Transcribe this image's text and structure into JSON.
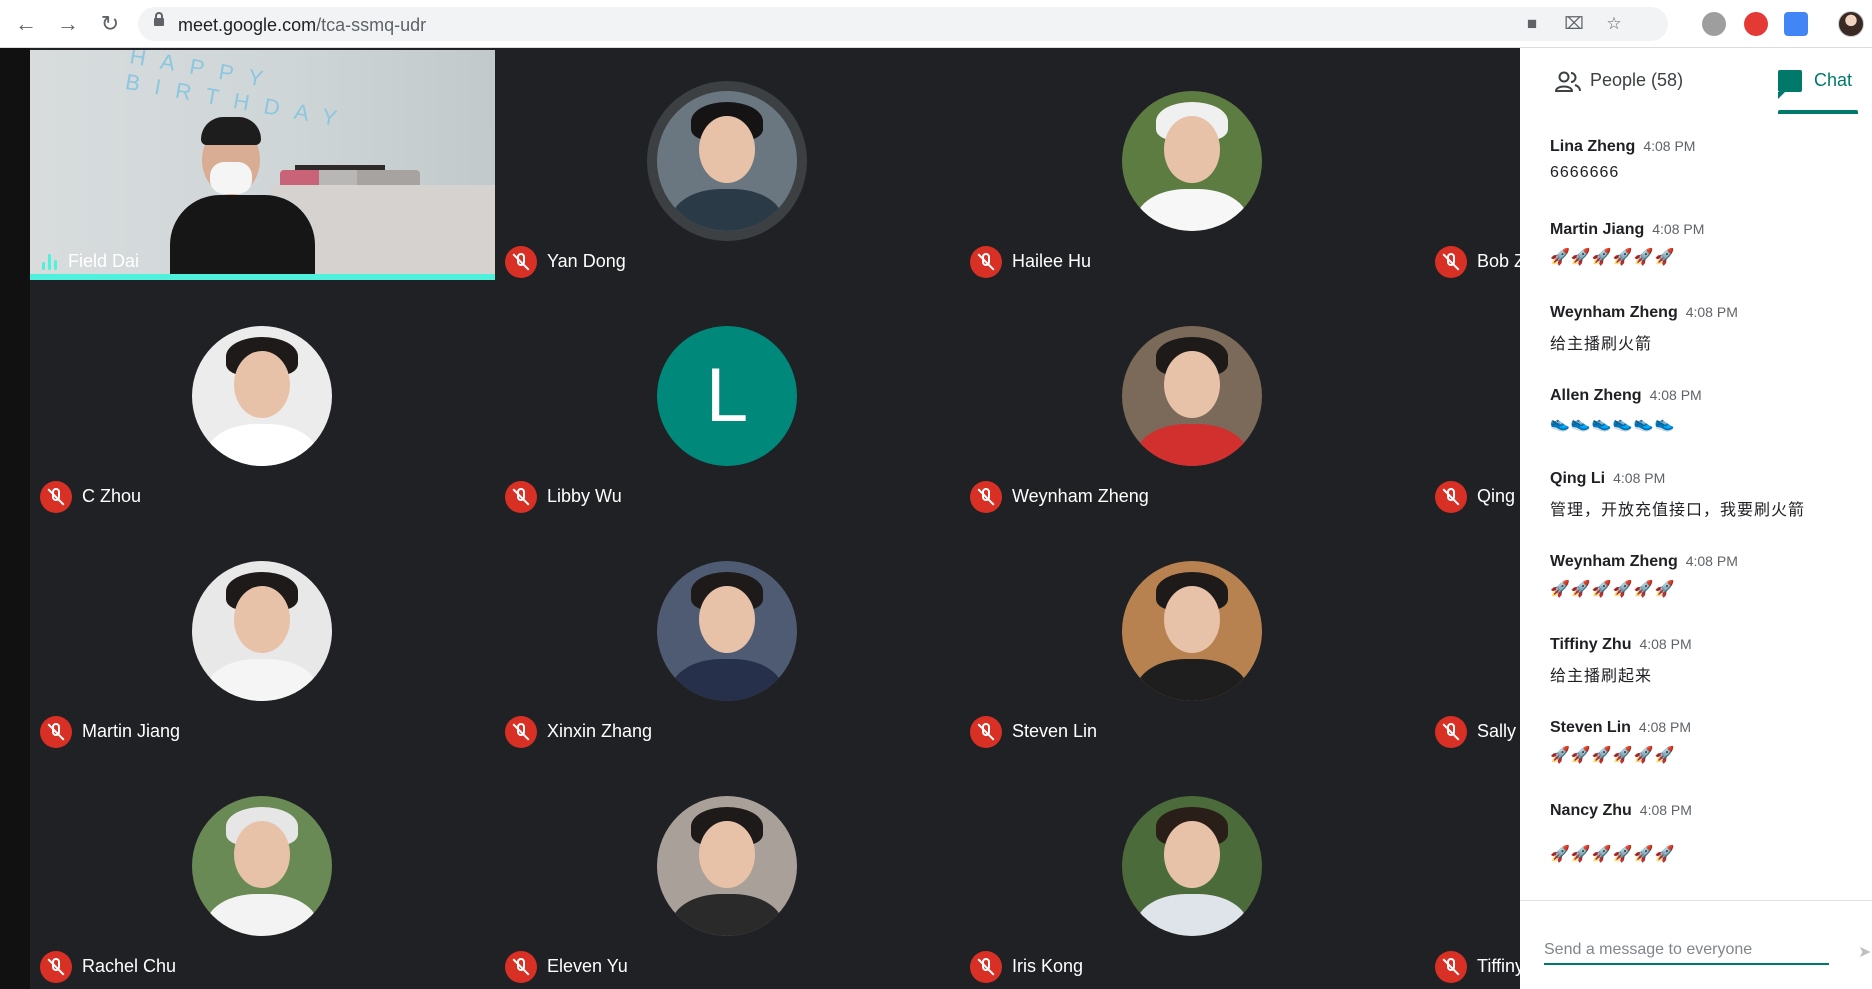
{
  "browser": {
    "url_host": "meet.google.com",
    "url_path": "/tca-ssmq-udr"
  },
  "panel": {
    "people_tab": "People (58)",
    "chat_tab": "Chat",
    "composer_placeholder": "Send a message to everyone"
  },
  "participants": [
    {
      "name": "Field Dai",
      "speaking": true,
      "video": true
    },
    {
      "name": "Yan Dong",
      "muted": true
    },
    {
      "name": "Hailee Hu",
      "muted": true
    },
    {
      "name": "Bob Z",
      "muted": true
    },
    {
      "name": "C Zhou",
      "muted": true
    },
    {
      "name": "Libby Wu",
      "muted": true,
      "avatar_letter": "L"
    },
    {
      "name": "Weynham Zheng",
      "muted": true
    },
    {
      "name": "Qing",
      "muted": true
    },
    {
      "name": "Martin Jiang",
      "muted": true
    },
    {
      "name": "Xinxin Zhang",
      "muted": true
    },
    {
      "name": "Steven Lin",
      "muted": true
    },
    {
      "name": "Sally",
      "muted": true
    },
    {
      "name": "Rachel Chu",
      "muted": true
    },
    {
      "name": "Eleven Yu",
      "muted": true
    },
    {
      "name": "Iris Kong",
      "muted": true
    },
    {
      "name": "Tiffiny",
      "muted": true
    }
  ],
  "messages": [
    {
      "sender": "Lina Zheng",
      "time": "4:08 PM",
      "text": "6666666"
    },
    {
      "sender": "Martin Jiang",
      "time": "4:08 PM",
      "text": "🚀🚀🚀🚀🚀🚀"
    },
    {
      "sender": "Weynham Zheng",
      "time": "4:08 PM",
      "text": "给主播刷火箭"
    },
    {
      "sender": "Allen Zheng",
      "time": "4:08 PM",
      "text": "👟👟👟👟👟👟"
    },
    {
      "sender": "Qing Li",
      "time": "4:08 PM",
      "text": "管理，开放充值接口，我要刷火箭"
    },
    {
      "sender": "Weynham Zheng",
      "time": "4:08 PM",
      "text": "🚀🚀🚀🚀🚀🚀"
    },
    {
      "sender": "Tiffiny Zhu",
      "time": "4:08 PM",
      "text": "给主播刷起来"
    },
    {
      "sender": "Steven Lin",
      "time": "4:08 PM",
      "text": "🚀🚀🚀🚀🚀🚀"
    },
    {
      "sender": "Nancy Zhu",
      "time": "4:08 PM",
      "text": "🚀🚀🚀🚀🚀🚀"
    }
  ],
  "colors": {
    "accent": "#00796b",
    "muted_red": "#d93025",
    "stage_bg": "#202124",
    "speaking": "#4ff0dc"
  }
}
